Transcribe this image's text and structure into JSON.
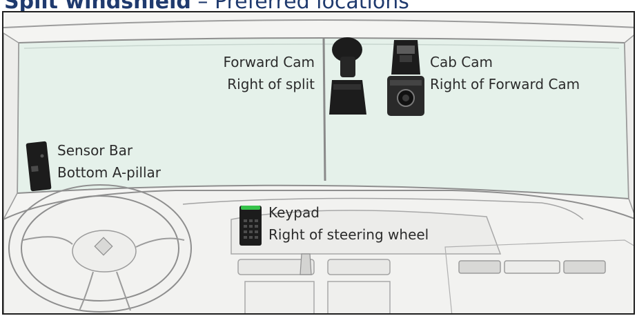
{
  "heading": {
    "bold": "Split windshield",
    "rest": " – Preferred locations"
  },
  "callouts": {
    "forward_cam": {
      "name": "Forward Cam",
      "location": "Right of split"
    },
    "cab_cam": {
      "name": "Cab Cam",
      "location": "Right of Forward Cam"
    },
    "sensor_bar": {
      "name": "Sensor Bar",
      "location": "Bottom A-pillar"
    },
    "keypad": {
      "name": "Keypad",
      "location": "Right of steering wheel"
    }
  },
  "colors": {
    "heading": "#1f3a6e",
    "glass": "#e6f2ec",
    "line": "#8e8e8e",
    "device": "#1c1c1c",
    "keypad_led": "#35c24a"
  }
}
